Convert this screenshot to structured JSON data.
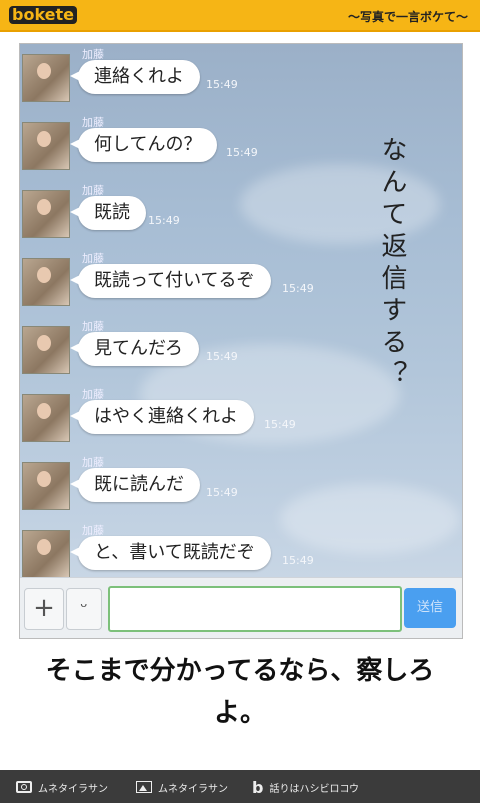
{
  "header": {
    "logo_text": "bokete",
    "tagline": "〜写真で一言ボケて〜",
    "colors": {
      "bar": "#f6b515",
      "logo": "#222222"
    }
  },
  "chat": {
    "sender": "加藤",
    "messages": [
      {
        "text": "連絡くれよ",
        "time": "15:49"
      },
      {
        "text": "何してんの？",
        "time": "15:49"
      },
      {
        "text": "既読",
        "time": "15:49"
      },
      {
        "text": "既読って付いてるぞ",
        "time": "15:49"
      },
      {
        "text": "見てんだろ",
        "time": "15:49"
      },
      {
        "text": "はやく連絡くれよ",
        "time": "15:49"
      },
      {
        "text": "既に読んだ",
        "time": "15:49"
      },
      {
        "text": "と、書いて既読だぞ",
        "time": "15:49"
      }
    ],
    "overlay_text": "なんて返信する？",
    "input": {
      "plus_icon": "plus-icon",
      "emoji_icon": "smile-icon",
      "send_label": "送信",
      "value": ""
    }
  },
  "caption": "そこまで分かってるなら、察しろよ。",
  "footer": {
    "photo_credit": "ムネタイラサン",
    "image_credit": "ムネタイラサン",
    "boke_credit": "話りはハシビロコウ"
  }
}
